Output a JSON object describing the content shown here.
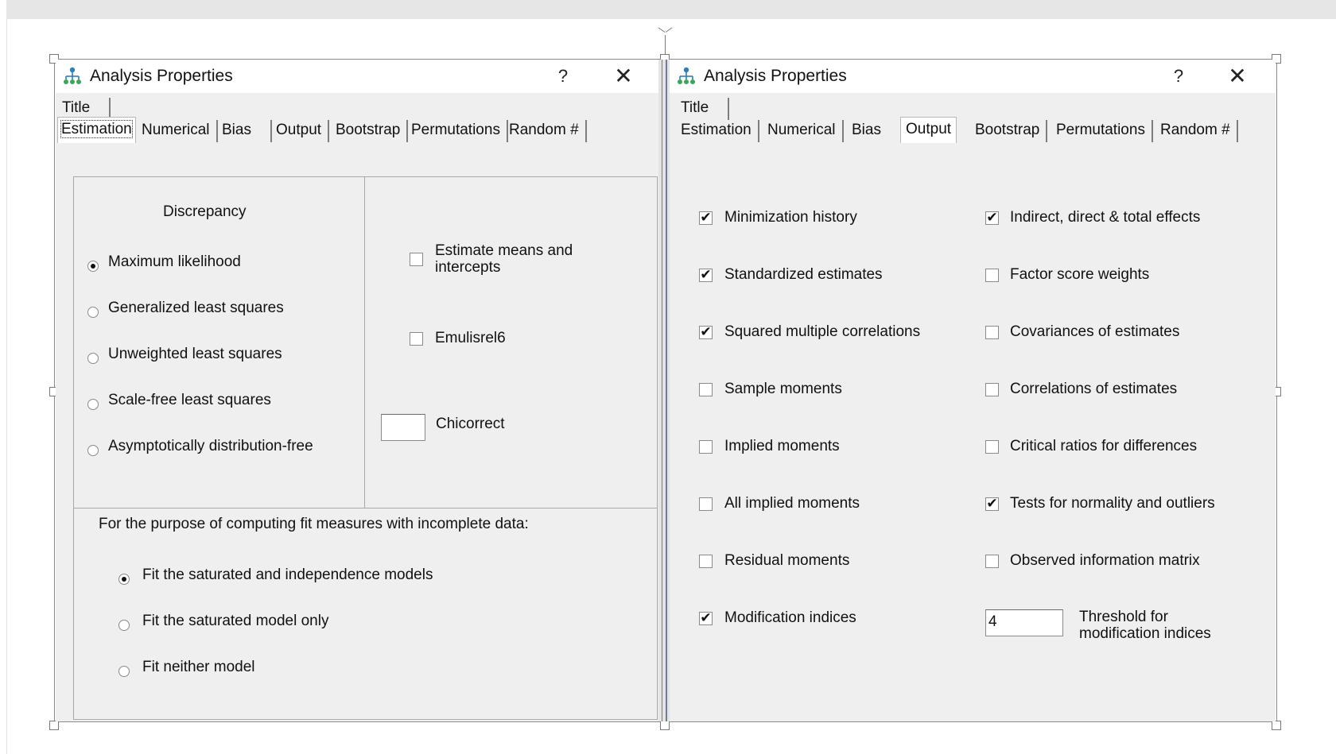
{
  "dialogs": {
    "left": {
      "title": "Analysis Properties",
      "help": "?",
      "close": "✕",
      "tabs_row1": [
        "Title"
      ],
      "tabs_row2": [
        "Estimation",
        "Numerical",
        "Bias",
        "Output",
        "Bootstrap",
        "Permutations",
        "Random #"
      ],
      "selected_tab": "Estimation",
      "discrepancy": {
        "heading": "Discrepancy",
        "options": [
          "Maximum likelihood",
          "Generalized least squares",
          "Unweighted least squares",
          "Scale-free least squares",
          "Asymptotically distribution-free"
        ],
        "selected": "Maximum likelihood"
      },
      "estimate_means": {
        "label_line1": "Estimate means and",
        "label_line2": "intercepts",
        "checked": false
      },
      "emulisrel6": {
        "label": "Emulisrel6",
        "checked": false
      },
      "chicorrect": {
        "label": "Chicorrect",
        "value": ""
      },
      "incomplete": {
        "heading": "For the purpose of computing fit measures with incomplete data:",
        "options": [
          "Fit the saturated and independence models",
          "Fit the saturated model only",
          "Fit neither model"
        ],
        "selected": "Fit the saturated and independence models"
      }
    },
    "right": {
      "title": "Analysis Properties",
      "help": "?",
      "close": "✕",
      "tabs_row1": [
        "Title"
      ],
      "tabs_row2": [
        "Estimation",
        "Numerical",
        "Bias",
        "Output",
        "Bootstrap",
        "Permutations",
        "Random #"
      ],
      "selected_tab": "Output",
      "options_left": [
        {
          "label": "Minimization history",
          "checked": true
        },
        {
          "label": "Standardized estimates",
          "checked": true
        },
        {
          "label": "Squared multiple correlations",
          "checked": true
        },
        {
          "label": "Sample moments",
          "checked": false
        },
        {
          "label": "Implied moments",
          "checked": false
        },
        {
          "label": "All implied moments",
          "checked": false
        },
        {
          "label": "Residual moments",
          "checked": false
        },
        {
          "label": "Modification indices",
          "checked": true
        }
      ],
      "options_right": [
        {
          "label": "Indirect, direct & total effects",
          "checked": true
        },
        {
          "label": "Factor score weights",
          "checked": false
        },
        {
          "label": "Covariances of estimates",
          "checked": false
        },
        {
          "label": "Correlations of estimates",
          "checked": false
        },
        {
          "label": "Critical ratios for differences",
          "checked": false
        },
        {
          "label": "Tests for normality and outliers",
          "checked": true
        },
        {
          "label": "Observed information matrix",
          "checked": false
        }
      ],
      "threshold": {
        "value": "4",
        "label_line1": "Threshold for",
        "label_line2": "modification indices"
      }
    }
  },
  "check_glyph": "✔",
  "icons": {
    "app": "amos-tree-icon"
  }
}
